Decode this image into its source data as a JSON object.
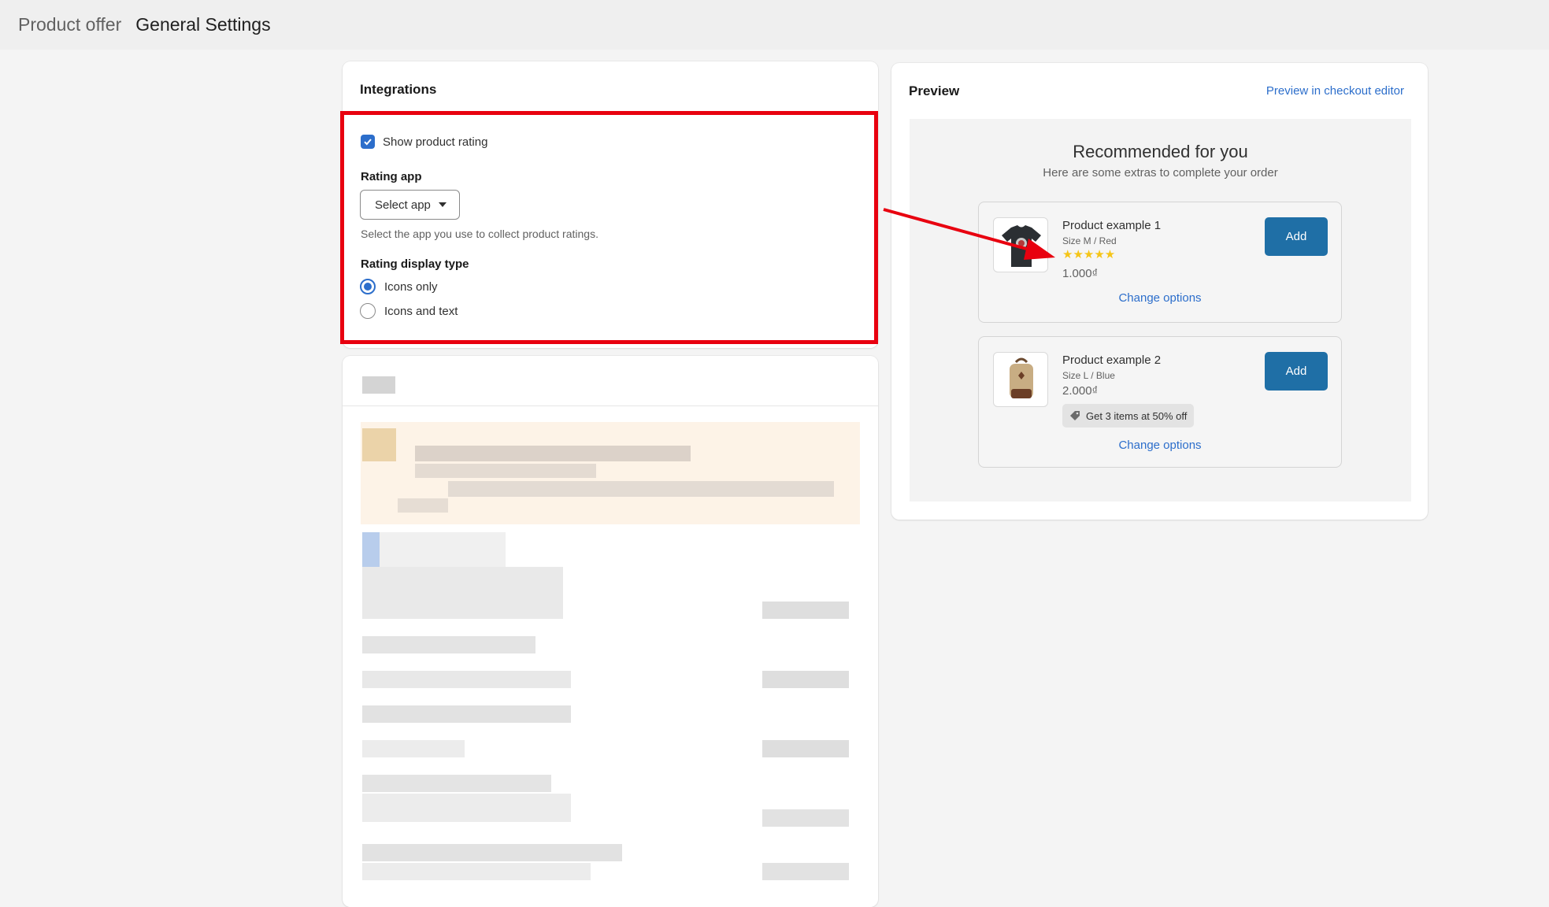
{
  "header": {
    "breadcrumb": "Product offer",
    "title": "General Settings"
  },
  "integrations": {
    "heading": "Integrations",
    "show_rating_label": "Show product rating",
    "show_rating_checked": true,
    "rating_app_label": "Rating app",
    "select_label": "Select app",
    "select_help": "Select the app you use to collect product ratings.",
    "display_type_label": "Rating display type",
    "display_options": [
      {
        "label": "Icons only",
        "selected": true
      },
      {
        "label": "Icons and text",
        "selected": false
      }
    ]
  },
  "preview": {
    "heading": "Preview",
    "checkout_link": "Preview in checkout editor",
    "rec_title": "Recommended for you",
    "rec_subtitle": "Here are some extras to complete your order",
    "products": [
      {
        "name": "Product example 1",
        "variant": "Size M / Red",
        "rating_stars": "★★★★★",
        "price": "1.000₫",
        "add_label": "Add",
        "change_label": "Change options",
        "icon": "tshirt-icon"
      },
      {
        "name": "Product example 2",
        "variant": "Size L / Blue",
        "price": "2.000₫",
        "discount": "Get 3 items at 50% off",
        "add_label": "Add",
        "change_label": "Change options",
        "icon": "backpack-icon"
      }
    ]
  },
  "colors": {
    "accent": "#2c6ecb",
    "add_button": "#1f6fa6",
    "annotation_red": "#e8000f",
    "star": "#f5c518"
  }
}
